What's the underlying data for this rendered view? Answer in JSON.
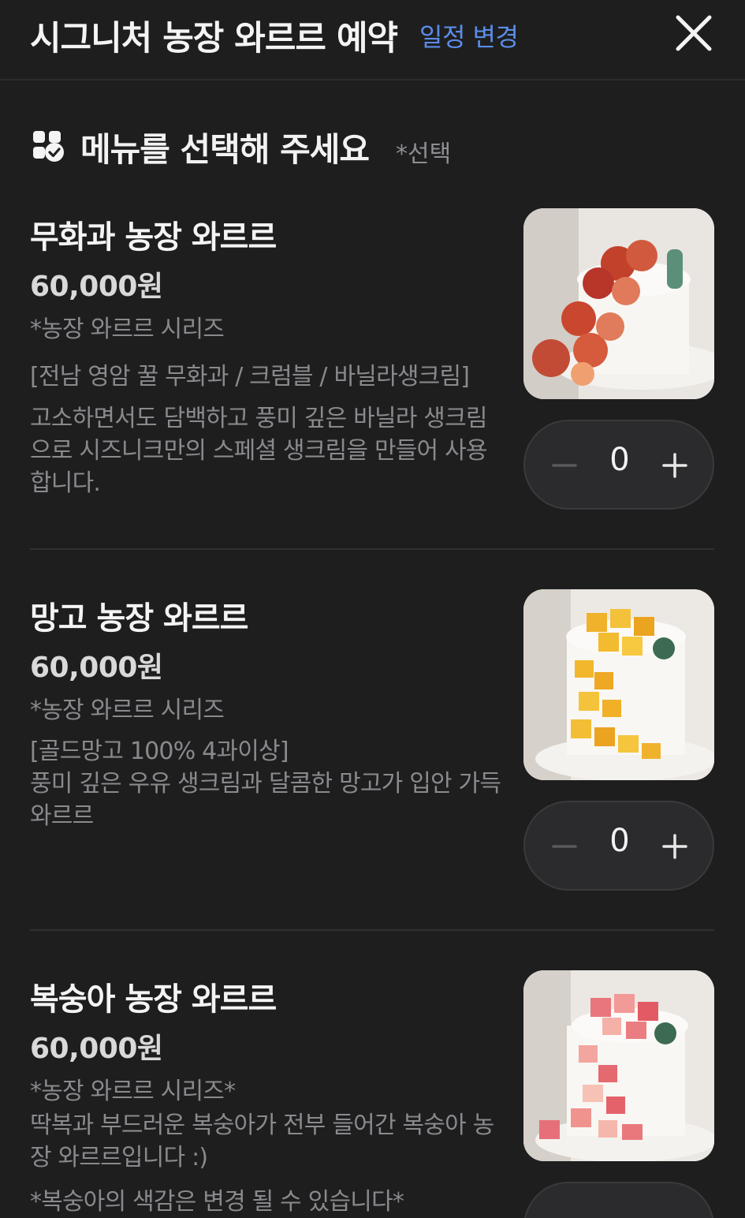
{
  "header": {
    "title": "시그니처 농장 와르르 예약",
    "change_schedule": "일정 변경"
  },
  "section": {
    "title": "메뉴를 선택해 주세요",
    "note": "*선택"
  },
  "items": [
    {
      "name": "무화과 농장 와르르",
      "price": "60,000원",
      "lines": [
        "*농장 와르르 시리즈",
        "[전남 영암 꿀 무화과 / 크럼블 / 바닐라생크림]"
      ],
      "desc": "고소하면서도 담백하고 풍미 깊은 바닐라 생크림으로 시즈니크만의 스페셜 생크림을 만들어 사용합니다.",
      "quantity": "0",
      "image": "fig-cake"
    },
    {
      "name": "망고 농장 와르르",
      "price": "60,000원",
      "lines": [
        "*농장 와르르 시리즈",
        "[골드망고 100% 4과이상]"
      ],
      "desc": "풍미 깊은 우유 생크림과 달콤한 망고가 입안 가득 와르르",
      "quantity": "0",
      "image": "mango-cake"
    },
    {
      "name": "복숭아 농장 와르르",
      "price": "60,000원",
      "lines": [
        "*농장 와르르 시리즈*"
      ],
      "desc": "딱복과 부드러운 복숭아가 전부 들어간 복숭아 농장 와르르입니다 :)",
      "note": "*복숭아의 색감은 변경 될 수 있습니다*",
      "image": "peach-cake"
    }
  ],
  "colors": {
    "background": "#1e1e1f",
    "accent": "#5b8de8",
    "muted_text": "#8a8a8e"
  },
  "icons": {
    "close": "close-icon",
    "menu": "menu-check-icon",
    "minus": "minus-icon",
    "plus": "plus-icon"
  }
}
